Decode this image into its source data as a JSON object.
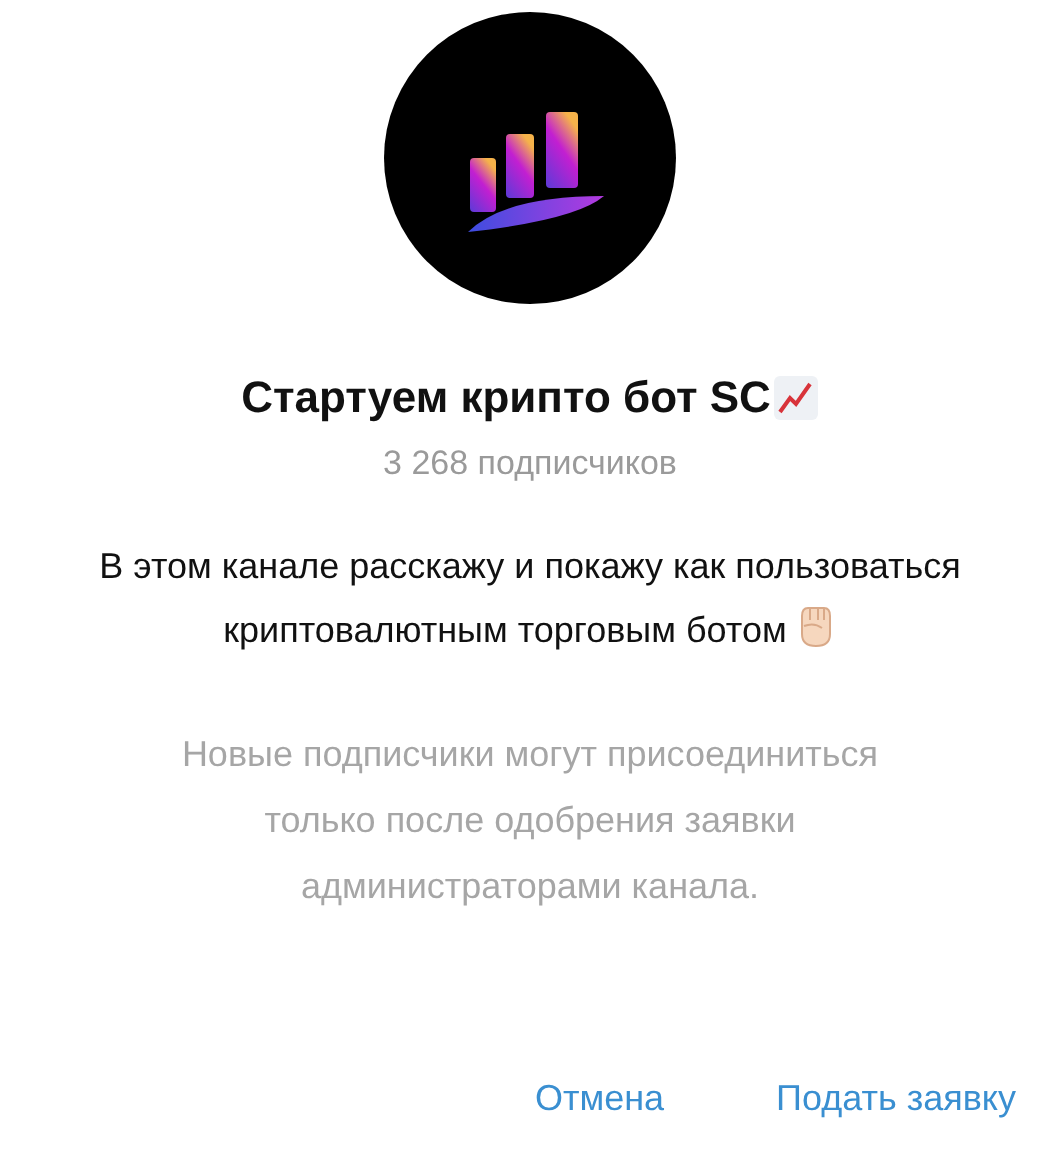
{
  "channel": {
    "title": "Стартуем крипто бот SC",
    "subscribers": "3 268 подписчиков",
    "description": "В этом канале расскажу и покажу как пользоваться криптовалютным торговым ботом"
  },
  "note": "Новые подписчики могут присоединиться только после одобрения заявки администраторами канала.",
  "buttons": [
    {
      "label": "Отмена"
    },
    {
      "label": "Подать заявку"
    }
  ]
}
